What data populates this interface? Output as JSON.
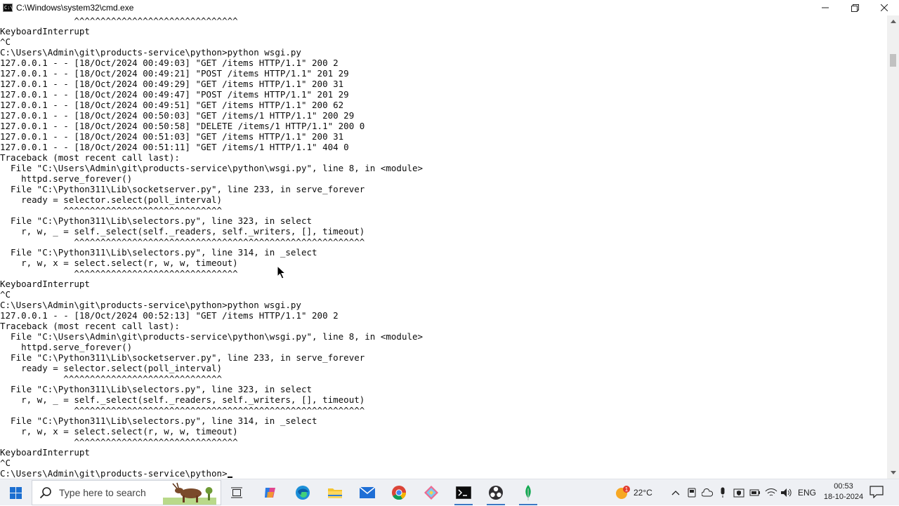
{
  "window": {
    "title": "C:\\Windows\\system32\\cmd.exe",
    "icon": "cmd-icon",
    "controls": {
      "minimize": "—",
      "restore": "❐",
      "close": "✕"
    }
  },
  "console": {
    "lines": [
      "              ^^^^^^^^^^^^^^^^^^^^^^^^^^^^^^^",
      "KeyboardInterrupt",
      "^C",
      "C:\\Users\\Admin\\git\\products-service\\python>python wsgi.py",
      "127.0.0.1 - - [18/Oct/2024 00:49:03] \"GET /items HTTP/1.1\" 200 2",
      "127.0.0.1 - - [18/Oct/2024 00:49:21] \"POST /items HTTP/1.1\" 201 29",
      "127.0.0.1 - - [18/Oct/2024 00:49:29] \"GET /items HTTP/1.1\" 200 31",
      "127.0.0.1 - - [18/Oct/2024 00:49:47] \"POST /items HTTP/1.1\" 201 29",
      "127.0.0.1 - - [18/Oct/2024 00:49:51] \"GET /items HTTP/1.1\" 200 62",
      "127.0.0.1 - - [18/Oct/2024 00:50:03] \"GET /items/1 HTTP/1.1\" 200 29",
      "127.0.0.1 - - [18/Oct/2024 00:50:58] \"DELETE /items/1 HTTP/1.1\" 200 0",
      "127.0.0.1 - - [18/Oct/2024 00:51:03] \"GET /items HTTP/1.1\" 200 31",
      "127.0.0.1 - - [18/Oct/2024 00:51:11] \"GET /items/1 HTTP/1.1\" 404 0",
      "Traceback (most recent call last):",
      "  File \"C:\\Users\\Admin\\git\\products-service\\python\\wsgi.py\", line 8, in <module>",
      "    httpd.serve_forever()",
      "  File \"C:\\Python311\\Lib\\socketserver.py\", line 233, in serve_forever",
      "    ready = selector.select(poll_interval)",
      "            ^^^^^^^^^^^^^^^^^^^^^^^^^^^^^^",
      "  File \"C:\\Python311\\Lib\\selectors.py\", line 323, in select",
      "    r, w, _ = self._select(self._readers, self._writers, [], timeout)",
      "              ^^^^^^^^^^^^^^^^^^^^^^^^^^^^^^^^^^^^^^^^^^^^^^^^^^^^^^^",
      "  File \"C:\\Python311\\Lib\\selectors.py\", line 314, in _select",
      "    r, w, x = select.select(r, w, w, timeout)",
      "              ^^^^^^^^^^^^^^^^^^^^^^^^^^^^^^^",
      "KeyboardInterrupt",
      "^C",
      "C:\\Users\\Admin\\git\\products-service\\python>python wsgi.py",
      "127.0.0.1 - - [18/Oct/2024 00:52:13] \"GET /items HTTP/1.1\" 200 2",
      "Traceback (most recent call last):",
      "  File \"C:\\Users\\Admin\\git\\products-service\\python\\wsgi.py\", line 8, in <module>",
      "    httpd.serve_forever()",
      "  File \"C:\\Python311\\Lib\\socketserver.py\", line 233, in serve_forever",
      "    ready = selector.select(poll_interval)",
      "            ^^^^^^^^^^^^^^^^^^^^^^^^^^^^^^",
      "  File \"C:\\Python311\\Lib\\selectors.py\", line 323, in select",
      "    r, w, _ = self._select(self._readers, self._writers, [], timeout)",
      "              ^^^^^^^^^^^^^^^^^^^^^^^^^^^^^^^^^^^^^^^^^^^^^^^^^^^^^^^",
      "  File \"C:\\Python311\\Lib\\selectors.py\", line 314, in _select",
      "    r, w, x = select.select(r, w, w, timeout)",
      "              ^^^^^^^^^^^^^^^^^^^^^^^^^^^^^^^",
      "KeyboardInterrupt",
      "^C"
    ],
    "prompt": "C:\\Users\\Admin\\git\\products-service\\python>"
  },
  "taskbar": {
    "start_icon": "windows-start-icon",
    "search_placeholder": "Type here to search",
    "apps": [
      {
        "name": "task-view",
        "icon": "task-view-icon"
      },
      {
        "name": "copilot",
        "icon": "copilot-icon"
      },
      {
        "name": "edge",
        "icon": "edge-icon"
      },
      {
        "name": "file-explorer",
        "icon": "folder-icon"
      },
      {
        "name": "mail",
        "icon": "mail-icon"
      },
      {
        "name": "chrome",
        "icon": "chrome-icon"
      },
      {
        "name": "git-tool",
        "icon": "git-diamond-icon"
      },
      {
        "name": "command-prompt",
        "icon": "terminal-icon"
      },
      {
        "name": "obs",
        "icon": "obs-icon"
      },
      {
        "name": "mongodb",
        "icon": "leaf-icon"
      }
    ],
    "weather": {
      "badge": "1",
      "temperature": "22°C"
    },
    "language": "ENG",
    "clock": {
      "time": "00:53",
      "date": "18-10-2024"
    }
  },
  "colors": {
    "console_bg": "#ffffff",
    "console_fg": "#0c0c0c",
    "taskbar_bg": "#eef0f4",
    "accent": "#3b78c4"
  }
}
